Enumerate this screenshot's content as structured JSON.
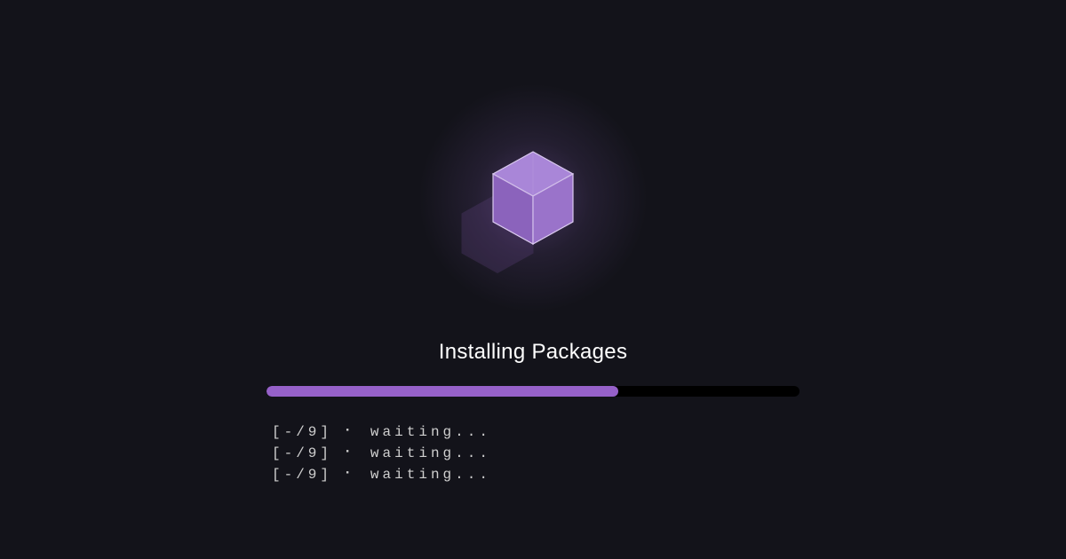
{
  "title": "Installing Packages",
  "progress": {
    "percent": 66
  },
  "logs": [
    "[-/9] ⠂ waiting...",
    "[-/9] ⠂ waiting...",
    "[-/9] ⠂ waiting..."
  ],
  "colors": {
    "background": "#13131a",
    "accent": "#9661c9",
    "text": "#ffffff",
    "log_text": "#cfcfcf"
  }
}
